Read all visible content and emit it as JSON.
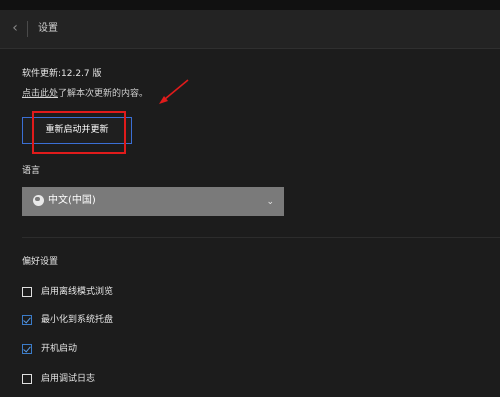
{
  "header": {
    "back_icon": "chevron-left-icon",
    "title": "设置"
  },
  "update": {
    "version_label": "软件更新:12.2.7 版",
    "link_text": "点击此处",
    "link_suffix": "了解本次更新的内容。",
    "button_label": "重新启动并更新"
  },
  "language": {
    "label": "语言",
    "selected": "中文(中国)",
    "icon": "globe-icon"
  },
  "preferences": {
    "label": "偏好设置",
    "items": [
      {
        "label": "启用离线模式浏览",
        "checked": false
      },
      {
        "label": "最小化到系统托盘",
        "checked": true
      },
      {
        "label": "开机启动",
        "checked": true
      },
      {
        "label": "启用调试日志",
        "checked": false
      }
    ]
  },
  "annotation": {
    "color": "#e01b1b"
  }
}
